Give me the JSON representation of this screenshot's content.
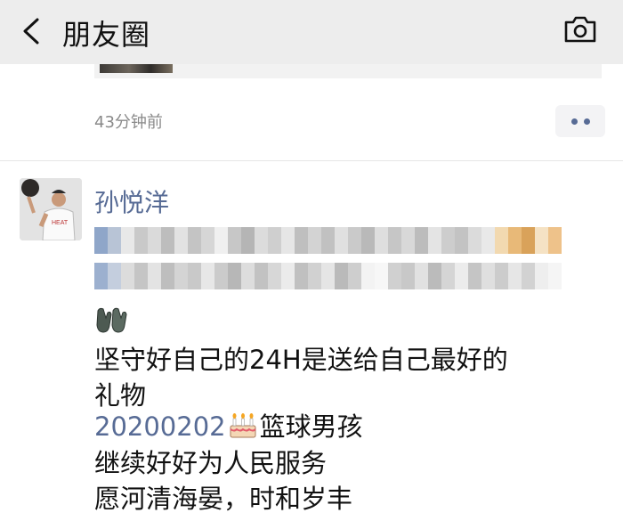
{
  "header": {
    "title": "朋友圈"
  },
  "previous_post": {
    "time_ago": "43分钟前"
  },
  "post": {
    "author": "孙悦洋",
    "lines": {
      "line1": "坚守好自己的24H是送给自己最好的",
      "line2": "礼物",
      "date": "20200202",
      "line3_after_date": "篮球男孩",
      "line4": "继续好好为人民服务",
      "line5": "愿河清海晏，时和岁丰"
    },
    "emoji": [
      "gloves-icon",
      "birthday-cake-icon"
    ]
  },
  "colors": {
    "header_bg": "#ededed",
    "link_blue": "#576b95",
    "text": "#111111",
    "meta_gray": "#8a8a8a"
  }
}
